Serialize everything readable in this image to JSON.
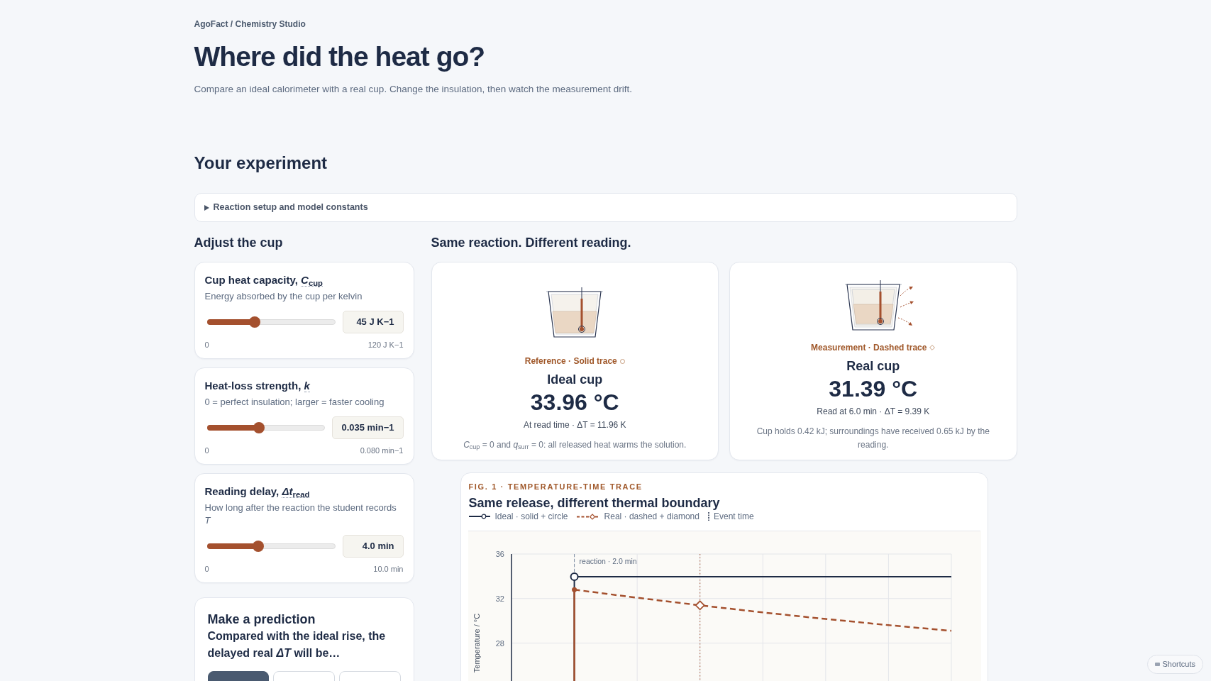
{
  "header": {
    "breadcrumb": "AgoFact / Chemistry Studio",
    "title": "Where did the heat go?",
    "subtitle": "Compare an ideal calorimeter with a real cup. Change the insulation, then watch the measurement drift."
  },
  "section_title": "Your experiment",
  "setup_panel": {
    "summary": "Reaction setup and model constants",
    "expanded": false
  },
  "controls_heading": "Adjust the cup",
  "controls": [
    {
      "label": "Cup heat capacity,",
      "symbol": "*C*$_{cup}$",
      "description": "Energy absorbed by the cup per kelvin",
      "level": 0.375,
      "value": "45 J K−1",
      "min": "0",
      "max": "120 J K−1"
    },
    {
      "label": "Heat-loss strength,",
      "symbol": "*k*",
      "description": "0 = perfect insulation; larger = faster cooling",
      "level": 0.4375,
      "value": "0.035 min−1",
      "min": "0",
      "max": "0.080 min−1"
    },
    {
      "label": "Reading delay,",
      "symbol": "*Δt*$_{read}$",
      "description": "How long after the reaction the student records *T*",
      "level": 0.4,
      "value": "4.0 min",
      "min": "0",
      "max": "10.0 min"
    }
  ],
  "prediction": {
    "title": "Make a prediction",
    "question": "Compared with the ideal rise, the delayed real *ΔT* will be…",
    "options": [
      {
        "selected": true
      },
      {
        "selected": false
      },
      {
        "selected": false
      }
    ]
  },
  "readings_heading": "Same reaction. Different reading.",
  "readings": [
    {
      "kind": "ideal",
      "tag": "Reference · Solid trace",
      "title": "Ideal cup",
      "value": "33.96 °C",
      "detail": "At read time · ΔT = 11.96 K",
      "note": "*C*$_{cup}$ = 0 and *q*$_{surr}$ = 0: all released heat warms the solution."
    },
    {
      "kind": "real",
      "tag": "Measurement · Dashed trace",
      "title": "Real cup",
      "value": "31.39 °C",
      "detail": "Read at 6.0 min · ΔT = 9.39 K",
      "note": "Cup holds 0.42 kJ; surroundings have received 0.65 kJ by the reading."
    }
  ],
  "figure": {
    "caption": "FIG. 1 · TEMPERATURE-TIME TRACE",
    "title": "Same release, different thermal boundary",
    "event_legend": "Event time",
    "event_label": "reaction · 2.0 min",
    "time_points": [
      {
        "kind": "event"
      },
      {
        "kind": "plain"
      },
      {
        "kind": "read"
      },
      {
        "kind": "plain"
      },
      {
        "kind": "plain"
      },
      {
        "kind": "plain"
      },
      {
        "kind": "plain"
      }
    ],
    "chart_data": {
      "type": "line",
      "ylabel": "Temperature / °C",
      "categories": [
        null,
        null,
        null,
        null,
        null,
        null,
        null
      ],
      "series": [
        {
          "name": "Ideal · solid + circle",
          "color": "#1e2b45",
          "line_style": "solid",
          "values": [
            33.96,
            33.96,
            33.96,
            33.96,
            33.96,
            33.96,
            33.96
          ]
        },
        {
          "name": "Real · dashed + diamond",
          "color": "#a4502e",
          "line_style": "dashed",
          "values": [
            32.8,
            32.07,
            31.39,
            30.75,
            30.16,
            29.61,
            29.1
          ]
        }
      ],
      "ylim": [
        20,
        36
      ],
      "yticks": [
        28,
        32,
        36
      ],
      "grid": true
    }
  },
  "shortcuts_button": "Shortcuts"
}
